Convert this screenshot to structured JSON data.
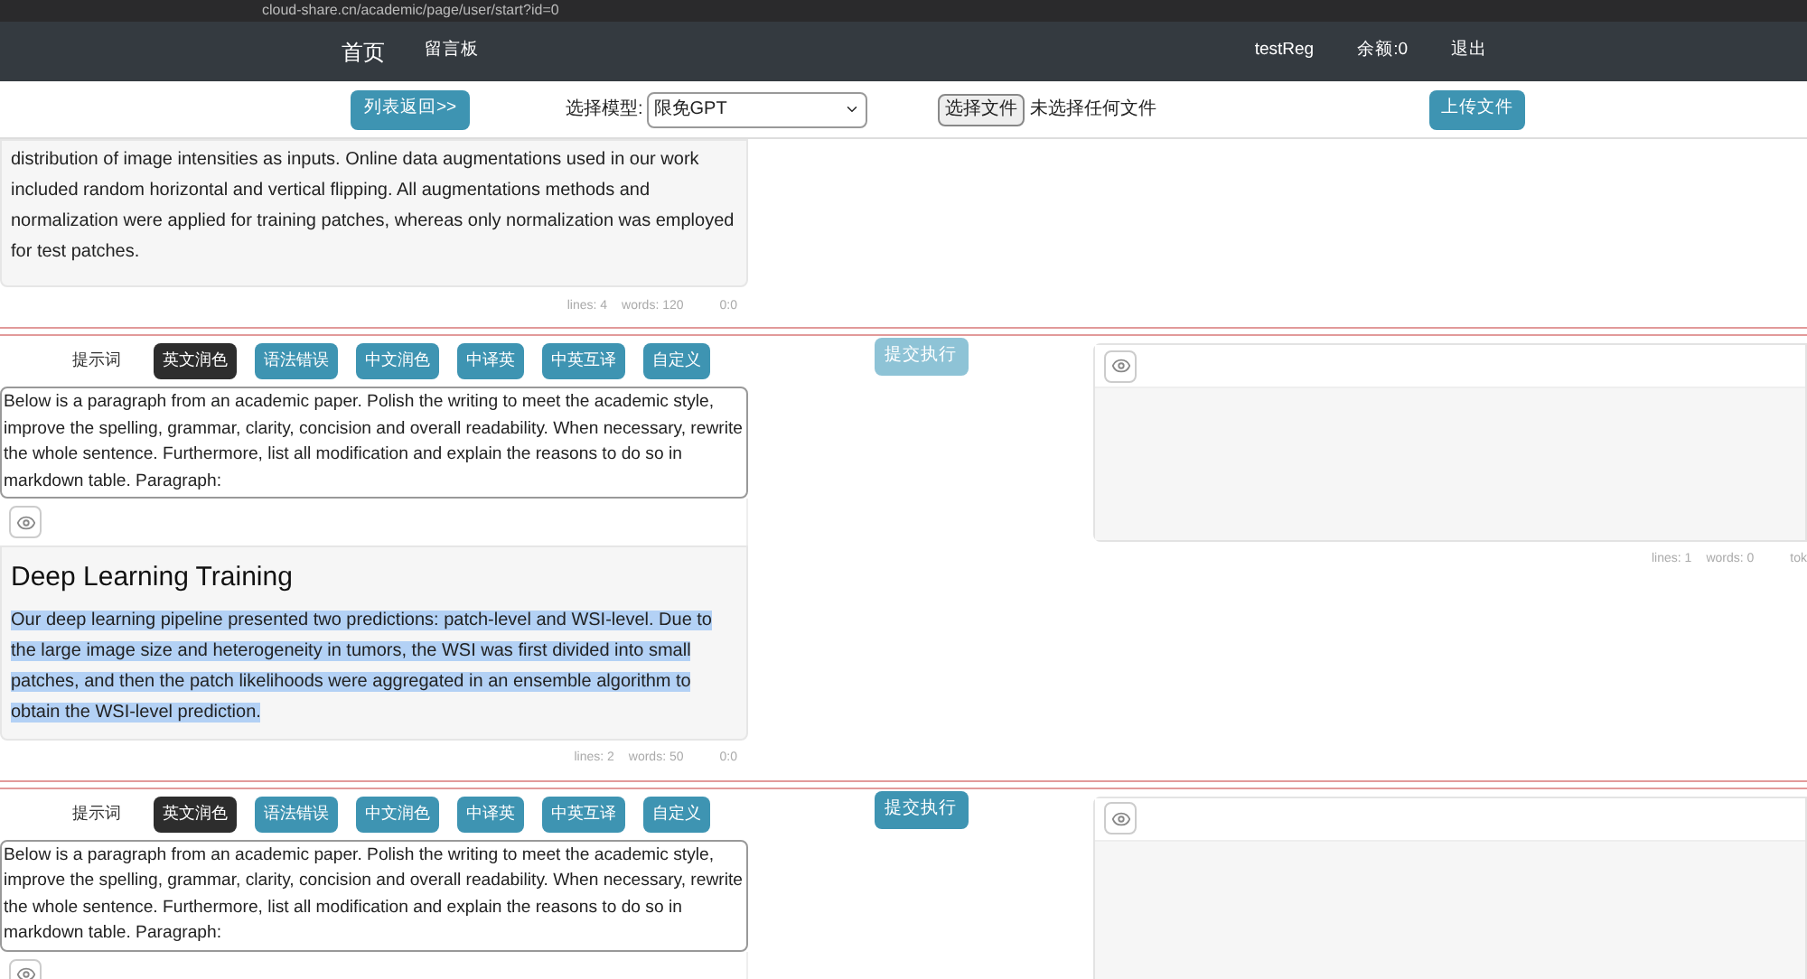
{
  "browser": {
    "url": "cloud-share.cn/academic/page/user/start?id=0"
  },
  "navbar": {
    "home": "首页",
    "links": [
      "留言板"
    ],
    "user": "testReg",
    "balance": "余额:0",
    "logout": "退出"
  },
  "toolbar": {
    "back_button": "列表返回>>",
    "model_label": "选择模型:",
    "model_value": "限免GPT",
    "file_button": "选择文件",
    "file_status": "未选择任何文件",
    "upload_button": "上传文件"
  },
  "sections": [
    {
      "result": {
        "paragraph": "distribution of image intensities as inputs. Online data augmentations used in our work included random horizontal and vertical flipping. All augmentations methods and normalization were applied for training patches, whereas only normalization was employed for test patches.",
        "selected": false,
        "stats": [
          "lines: 4",
          "words: 120",
          "0:0"
        ]
      }
    },
    {
      "prompt_label": "提示词",
      "prompts": [
        {
          "label": "英文润色",
          "selected": true
        },
        {
          "label": "语法错误",
          "selected": false
        },
        {
          "label": "中文润色",
          "selected": false
        },
        {
          "label": "中译英",
          "selected": false
        },
        {
          "label": "中英互译",
          "selected": false
        },
        {
          "label": "自定义",
          "selected": false
        }
      ],
      "prompt_text": "Below is a paragraph from an academic paper. Polish the writing to meet the academic style, improve the spelling, grammar, clarity, concision and overall readability. When necessary, rewrite the whole sentence. Furthermore, list all modification and explain the reasons to do so in markdown table. Paragraph:",
      "submit": {
        "label": "提交执行",
        "disabled": true
      },
      "result": {
        "heading": "Deep Learning Training",
        "paragraph": "Our deep learning pipeline presented two predictions: patch-level and WSI-level. Due to the large image size and heterogeneity in tumors, the WSI was first divided into small patches, and then the patch likelihoods were aggregated in an ensemble algorithm to obtain the WSI-level prediction.",
        "selected": true,
        "stats": [
          "lines: 2",
          "words: 50",
          "0:0"
        ]
      },
      "output_panel": true,
      "output_stats": [
        "lines: 1",
        "words: 0",
        "tok"
      ]
    },
    {
      "prompt_label": "提示词",
      "prompts": [
        {
          "label": "英文润色",
          "selected": true
        },
        {
          "label": "语法错误",
          "selected": false
        },
        {
          "label": "中文润色",
          "selected": false
        },
        {
          "label": "中译英",
          "selected": false
        },
        {
          "label": "中英互译",
          "selected": false
        },
        {
          "label": "自定义",
          "selected": false
        }
      ],
      "prompt_text": "Below is a paragraph from an academic paper. Polish the writing to meet the academic style, improve the spelling, grammar, clarity, concision and overall readability. When necessary, rewrite the whole sentence. Furthermore, list all modification and explain the reasons to do so in markdown table. Paragraph:",
      "submit": {
        "label": "提交执行",
        "disabled": false
      },
      "output_panel": true
    }
  ]
}
